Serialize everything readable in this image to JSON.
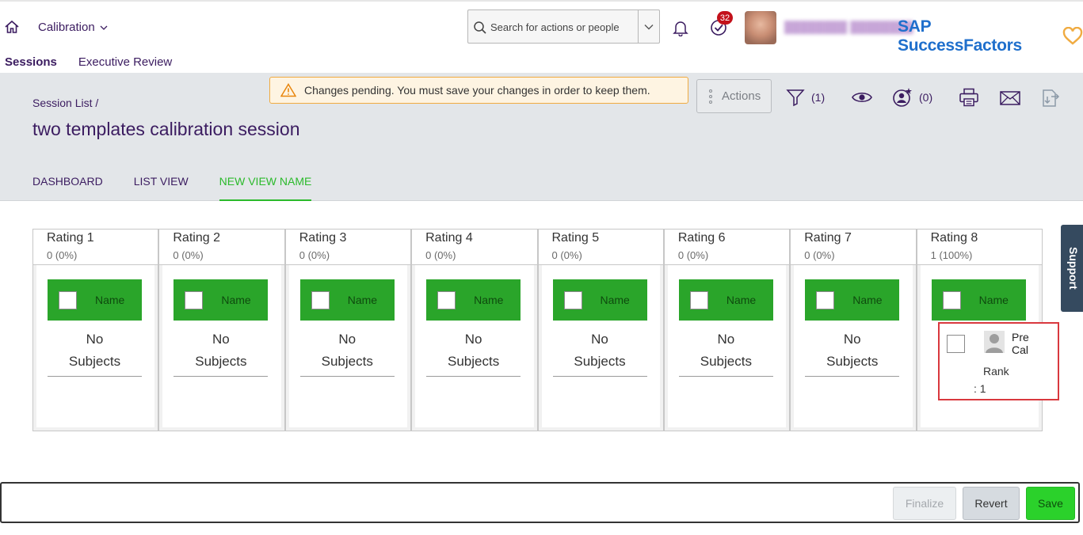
{
  "shell": {
    "module": "Calibration",
    "search_placeholder": "Search for actions or people",
    "notification_count": "32",
    "logo_text": "SAP SuccessFactors"
  },
  "subnav": [
    "Sessions",
    "Executive Review"
  ],
  "header": {
    "breadcrumb": "Session List /",
    "title": "two templates calibration session",
    "pending_message": "Changes pending. You must save your changes in order to keep them.",
    "actions_label": "Actions",
    "filter_count": "(1)",
    "team_count": "(0)"
  },
  "tabs": [
    "DASHBOARD",
    "LIST VIEW",
    "NEW VIEW NAME"
  ],
  "columns": [
    {
      "title": "Rating 1",
      "count": "0 (0%)",
      "name_label": "Name",
      "empty_line1": "No",
      "empty_line2": "Subjects"
    },
    {
      "title": "Rating 2",
      "count": "0 (0%)",
      "name_label": "Name",
      "empty_line1": "No",
      "empty_line2": "Subjects"
    },
    {
      "title": "Rating 3",
      "count": "0 (0%)",
      "name_label": "Name",
      "empty_line1": "No",
      "empty_line2": "Subjects"
    },
    {
      "title": "Rating 4",
      "count": "0 (0%)",
      "name_label": "Name",
      "empty_line1": "No",
      "empty_line2": "Subjects"
    },
    {
      "title": "Rating 5",
      "count": "0 (0%)",
      "name_label": "Name",
      "empty_line1": "No",
      "empty_line2": "Subjects"
    },
    {
      "title": "Rating 6",
      "count": "0 (0%)",
      "name_label": "Name",
      "empty_line1": "No",
      "empty_line2": "Subjects"
    },
    {
      "title": "Rating 7",
      "count": "0 (0%)",
      "name_label": "Name",
      "empty_line1": "No",
      "empty_line2": "Subjects"
    },
    {
      "title": "Rating 8",
      "count": "1 (100%)",
      "name_label": "Name"
    }
  ],
  "subject": {
    "name_line1": "Pre",
    "name_line2": "Cal",
    "rank_label": "Rank",
    "rank_value": ":  1"
  },
  "support_label": "Support",
  "footer": {
    "finalize": "Finalize",
    "revert": "Revert",
    "save": "Save"
  },
  "colors": {
    "accent_purple": "#3b1c60",
    "name_bar_green": "#2aa52a",
    "active_tab_green": "#2bba2b",
    "save_green": "#2bd12b",
    "highlight_red": "#d9383e",
    "brand_blue": "#1f6fcc"
  }
}
